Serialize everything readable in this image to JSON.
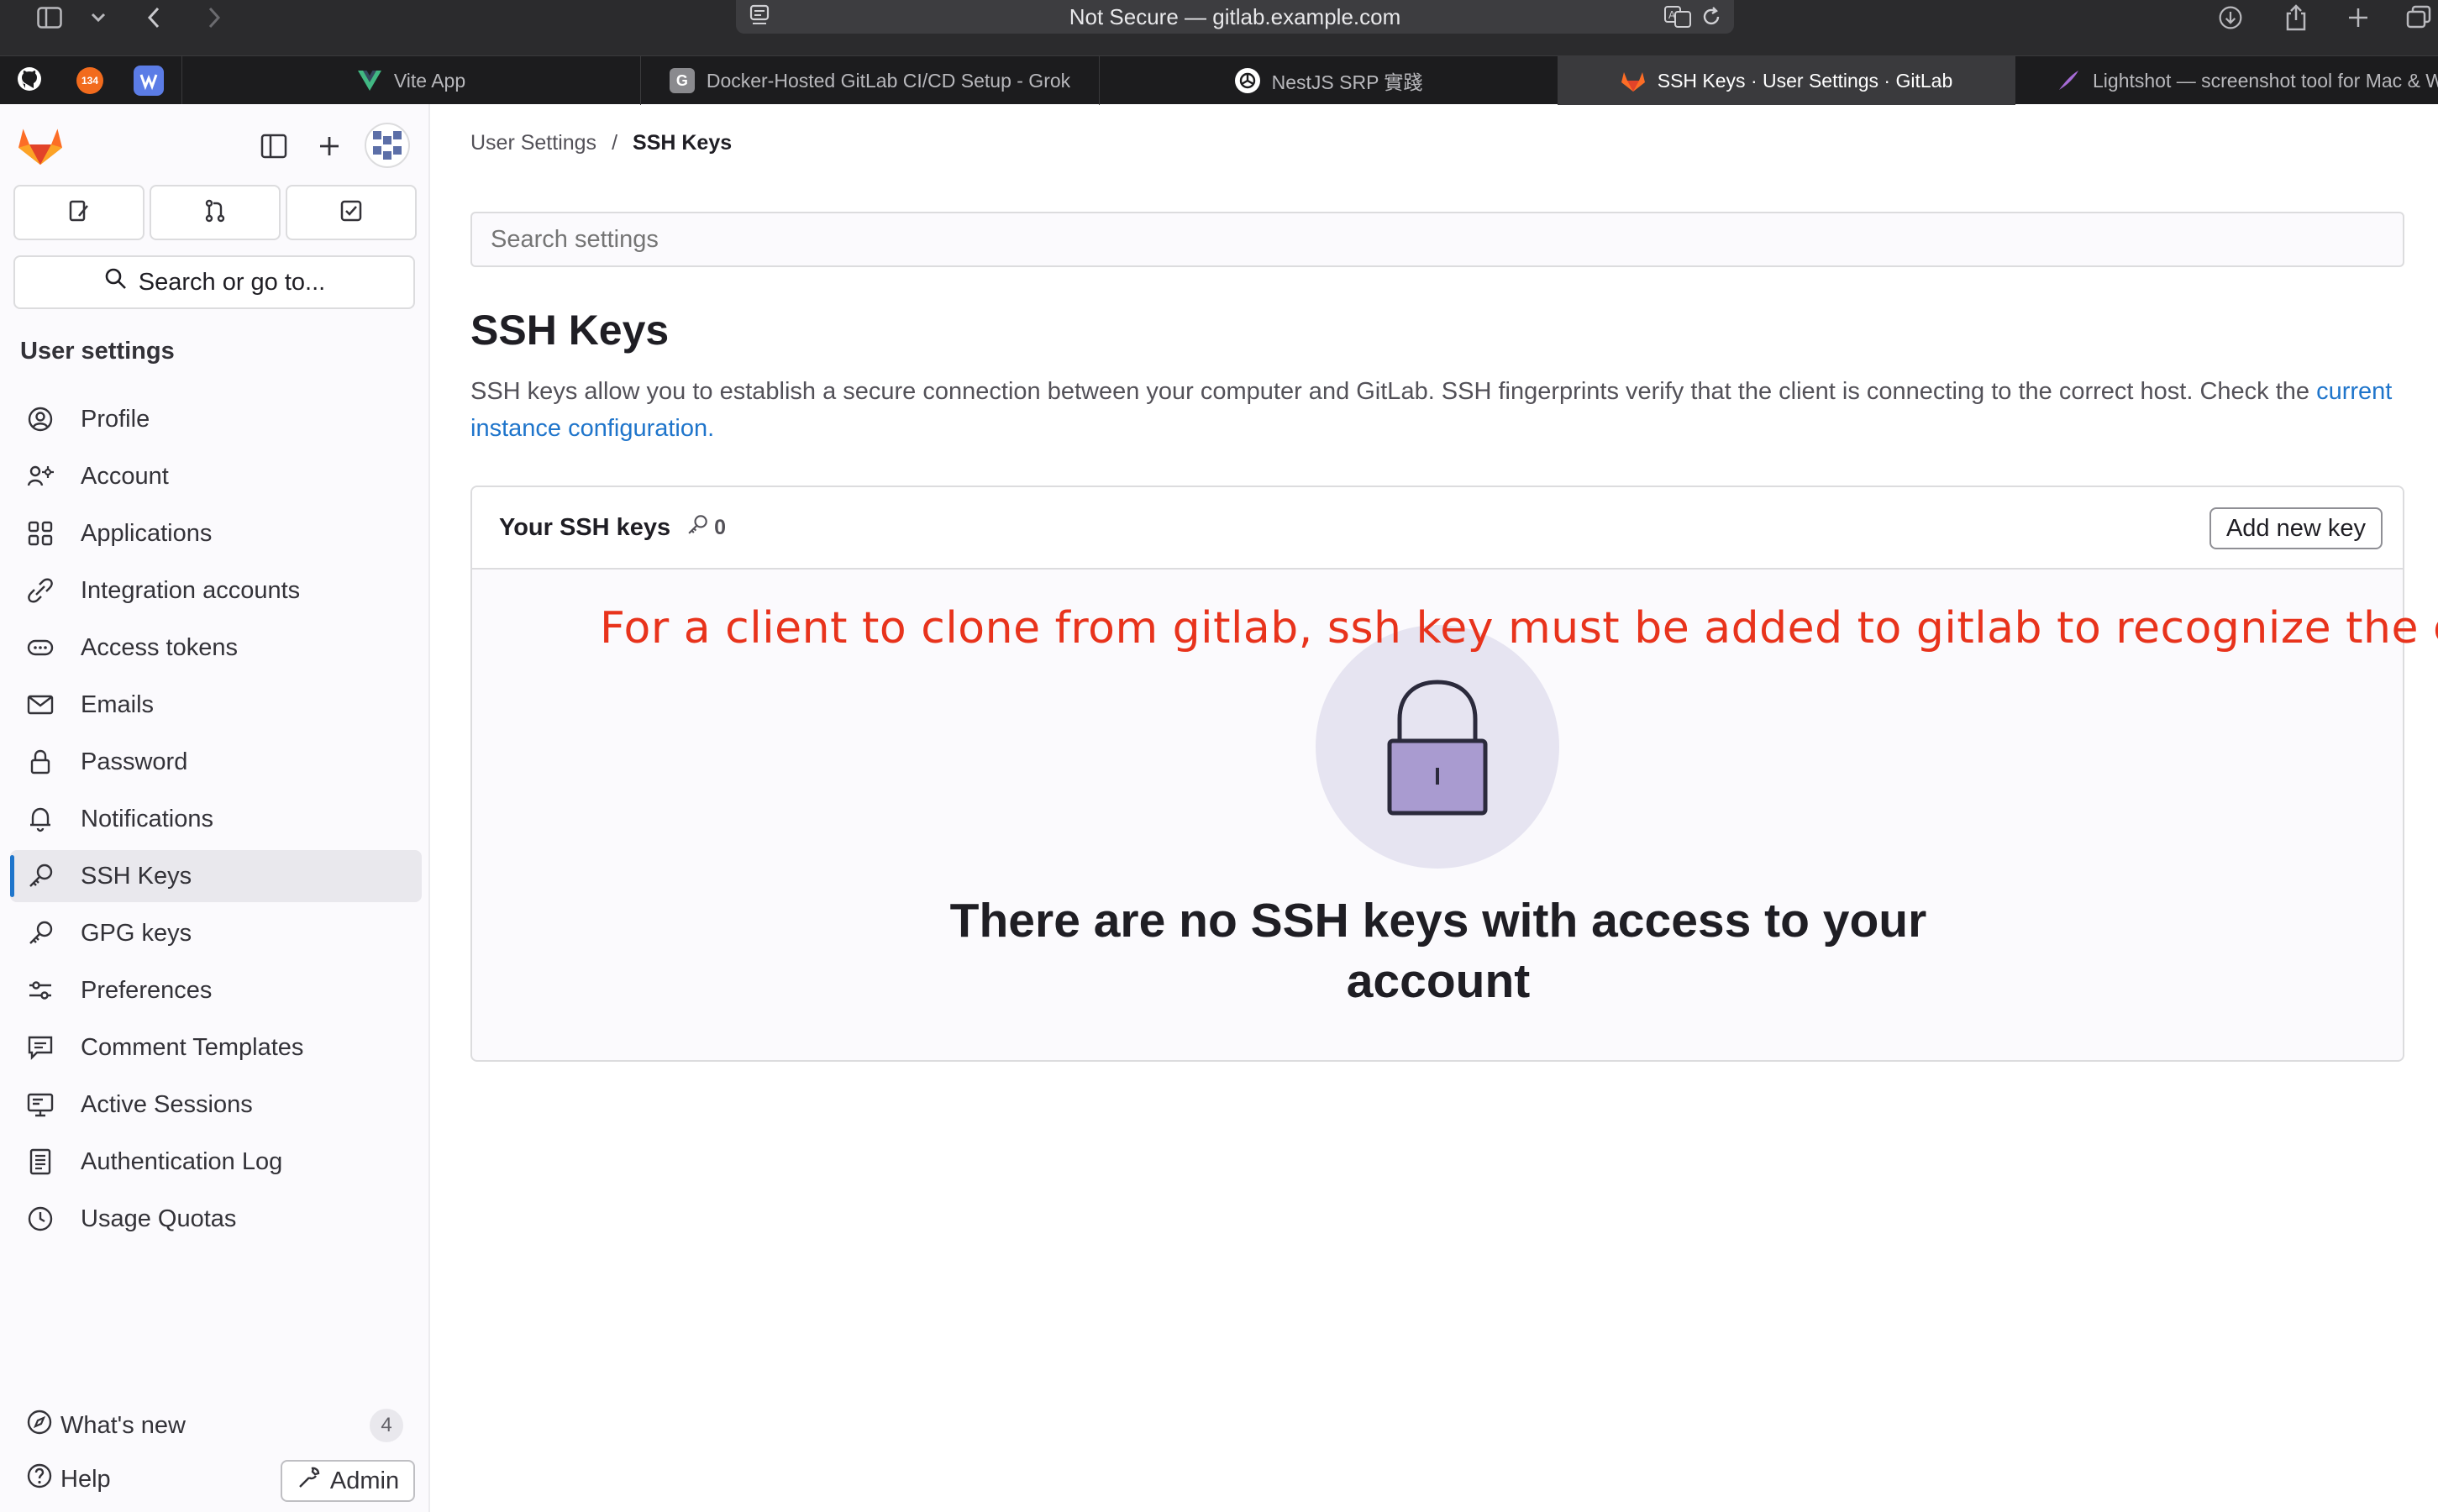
{
  "browser": {
    "address": "Not Secure — gitlab.example.com",
    "tabs": [
      {
        "label": "Vite App",
        "active": false,
        "icon": "vue-icon"
      },
      {
        "label": "Docker-Hosted GitLab CI/CD Setup - Grok",
        "active": false,
        "icon": "grok-icon"
      },
      {
        "label": "NestJS SRP 實踐",
        "active": false,
        "icon": "openai-icon"
      },
      {
        "label": "SSH Keys · User Settings · GitLab",
        "active": true,
        "icon": "gitlab-icon"
      },
      {
        "label": "Lightshot — screenshot tool for Mac & W",
        "active": false,
        "icon": "lightshot-icon"
      }
    ],
    "pinned": [
      "github-icon",
      "orange-pin-icon",
      "blue-pin-icon"
    ],
    "pinned_orange_text": "134"
  },
  "sidebar": {
    "search_label": "Search or go to...",
    "heading": "User settings",
    "items": [
      {
        "label": "Profile",
        "icon": "profile-icon"
      },
      {
        "label": "Account",
        "icon": "account-icon"
      },
      {
        "label": "Applications",
        "icon": "applications-icon"
      },
      {
        "label": "Integration accounts",
        "icon": "integration-icon"
      },
      {
        "label": "Access tokens",
        "icon": "token-icon"
      },
      {
        "label": "Emails",
        "icon": "mail-icon"
      },
      {
        "label": "Password",
        "icon": "lock-icon"
      },
      {
        "label": "Notifications",
        "icon": "bell-icon"
      },
      {
        "label": "SSH Keys",
        "icon": "key-icon",
        "active": true
      },
      {
        "label": "GPG keys",
        "icon": "key-icon"
      },
      {
        "label": "Preferences",
        "icon": "preferences-icon"
      },
      {
        "label": "Comment Templates",
        "icon": "comment-icon"
      },
      {
        "label": "Active Sessions",
        "icon": "monitor-icon"
      },
      {
        "label": "Authentication Log",
        "icon": "log-icon"
      },
      {
        "label": "Usage Quotas",
        "icon": "quota-icon"
      }
    ],
    "whats_new": "What's new",
    "whats_new_count": "4",
    "help": "Help",
    "admin": "Admin"
  },
  "main": {
    "breadcrumb": [
      "User Settings",
      "SSH Keys"
    ],
    "search_placeholder": "Search settings",
    "title": "SSH Keys",
    "description": "SSH keys allow you to establish a secure connection between your computer and GitLab. SSH fingerprints verify that the client is connecting to the correct host. Check the",
    "description_link": "current instance configuration",
    "card": {
      "title": "Your SSH keys",
      "count": "0",
      "add_button": "Add new key",
      "empty_message": "There are no SSH keys with access to your account"
    },
    "annotation": "For a client to clone from gitlab, ssh key must be added to gitlab to recognize the client"
  },
  "colors": {
    "accent": "#1f75cb",
    "annotation": "#e8331c",
    "gitlab_orange": "#fc6d26"
  }
}
